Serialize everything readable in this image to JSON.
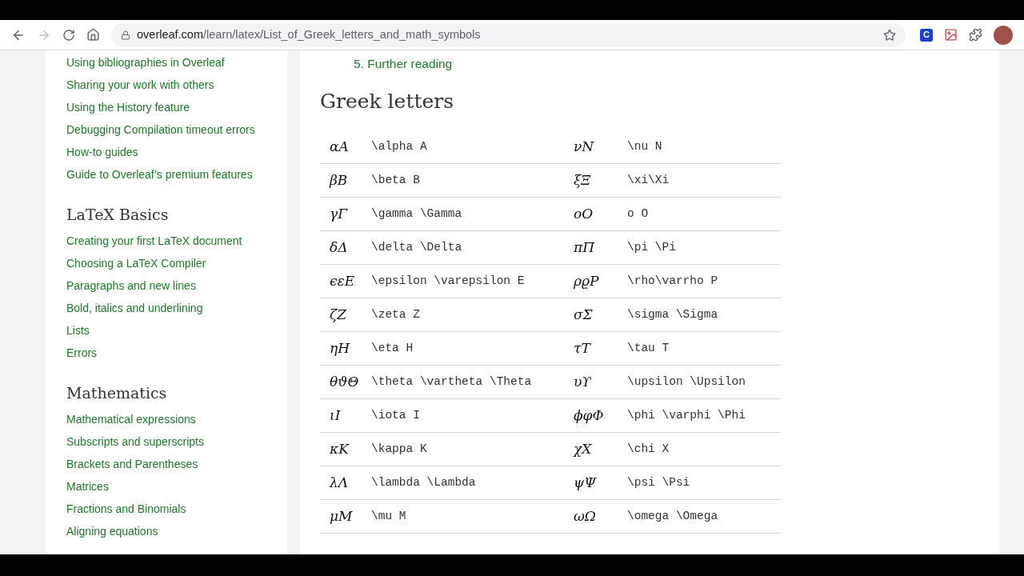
{
  "browser": {
    "url_host": "overleaf.com",
    "url_path": "/learn/latex/List_of_Greek_letters_and_math_symbols",
    "extension_label": "C"
  },
  "sidebar": {
    "sections": [
      {
        "links": [
          "Using bibliographies in Overleaf",
          "Sharing your work with others",
          "Using the History feature",
          "Debugging Compilation timeout errors",
          "How-to guides",
          "Guide to Overleaf’s premium features"
        ]
      },
      {
        "heading": "LaTeX Basics",
        "links": [
          "Creating your first LaTeX document",
          "Choosing a LaTeX Compiler",
          "Paragraphs and new lines",
          "Bold, italics and underlining",
          "Lists",
          "Errors"
        ]
      },
      {
        "heading": "Mathematics",
        "links": [
          "Mathematical expressions",
          "Subscripts and superscripts",
          "Brackets and Parentheses",
          "Matrices",
          "Fractions and Binomials",
          "Aligning equations"
        ]
      }
    ]
  },
  "main": {
    "toc_item": "5. Further reading",
    "heading": "Greek letters",
    "rows": [
      {
        "symbol": "αA",
        "code": "\\alpha A",
        "symbol_2": "νN",
        "code_2": "\\nu N"
      },
      {
        "symbol": "βB",
        "code": "\\beta B",
        "symbol_2": "ξΞ",
        "code_2": "\\xi\\Xi"
      },
      {
        "symbol": "γΓ",
        "code": "\\gamma \\Gamma",
        "symbol_2": "οO",
        "code_2": "o O"
      },
      {
        "symbol": "δΔ",
        "code": "\\delta \\Delta",
        "symbol_2": "πΠ",
        "code_2": "\\pi \\Pi"
      },
      {
        "symbol": "ϵεE",
        "code": "\\epsilon \\varepsilon E",
        "symbol_2": "ρϱP",
        "code_2": "\\rho\\varrho P"
      },
      {
        "symbol": "ζZ",
        "code": "\\zeta Z",
        "symbol_2": "σΣ",
        "code_2": "\\sigma \\Sigma"
      },
      {
        "symbol": "ηH",
        "code": "\\eta H",
        "symbol_2": "τT",
        "code_2": "\\tau T"
      },
      {
        "symbol": "θϑΘ",
        "code": "\\theta \\vartheta \\Theta",
        "symbol_2": "υϒ",
        "code_2": "\\upsilon \\Upsilon"
      },
      {
        "symbol": "ιI",
        "code": "\\iota I",
        "symbol_2": "ϕφΦ",
        "code_2": "\\phi \\varphi \\Phi"
      },
      {
        "symbol": "κK",
        "code": "\\kappa K",
        "symbol_2": "χX",
        "code_2": "\\chi X"
      },
      {
        "symbol": "λΛ",
        "code": "\\lambda \\Lambda",
        "symbol_2": "ψΨ",
        "code_2": "\\psi \\Psi"
      },
      {
        "symbol": "μM",
        "code": "\\mu M",
        "symbol_2": "ωΩ",
        "code_2": "\\omega \\Omega"
      }
    ]
  }
}
